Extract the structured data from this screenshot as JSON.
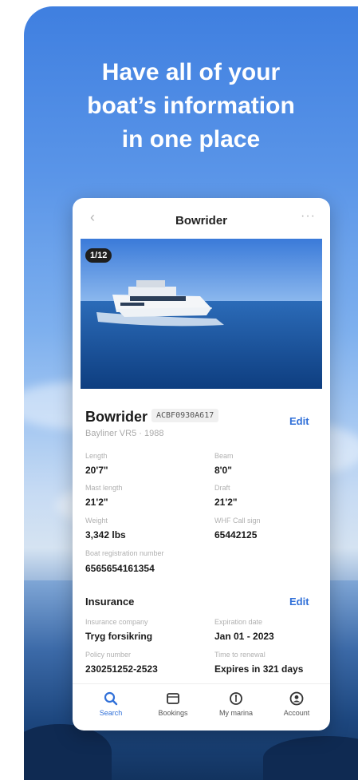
{
  "headline": {
    "line1": "Have all of your",
    "line2": "boat’s information",
    "line3": "in one place"
  },
  "header": {
    "back_icon": "chevron-left-icon",
    "title": "Bowrider",
    "more_icon": "more-horizontal-icon"
  },
  "photo": {
    "counter": "1/12"
  },
  "boat": {
    "name": "Bowrider",
    "code": "ACBF0930A617",
    "subtitle": "Bayliner VR5 · 1988",
    "edit_label": "Edit",
    "specs": {
      "length_label": "Length",
      "length_value": "20'7\"",
      "beam_label": "Beam",
      "beam_value": "8'0\"",
      "mast_length_label": "Mast length",
      "mast_length_value": "21'2\"",
      "draft_label": "Draft",
      "draft_value": "21'2\"",
      "weight_label": "Weight",
      "weight_value": "3,342 lbs",
      "whf_label": "WHF Call sign",
      "whf_value": "65442125",
      "registration_label": "Boat registration number",
      "registration_value": "6565654161354"
    }
  },
  "insurance": {
    "title": "Insurance",
    "edit_label": "Edit",
    "company_label": "Insurance company",
    "company_value": "Tryg forsikring",
    "expiration_label": "Expiration date",
    "expiration_value": "Jan 01 - 2023",
    "policy_label": "Policy number",
    "policy_value": "230251252-2523",
    "renewal_label": "Time to renewal",
    "renewal_value": "Expires in 321 days"
  },
  "nav": {
    "items": [
      {
        "label": "Search",
        "icon": "search-icon",
        "active": true
      },
      {
        "label": "Bookings",
        "icon": "bookings-icon",
        "active": false
      },
      {
        "label": "My marina",
        "icon": "marina-icon",
        "active": false
      },
      {
        "label": "Account",
        "icon": "account-icon",
        "active": false
      }
    ]
  },
  "colors": {
    "accent": "#2f6fd8",
    "text": "#1a1a1a",
    "muted": "#b0b0b0"
  }
}
